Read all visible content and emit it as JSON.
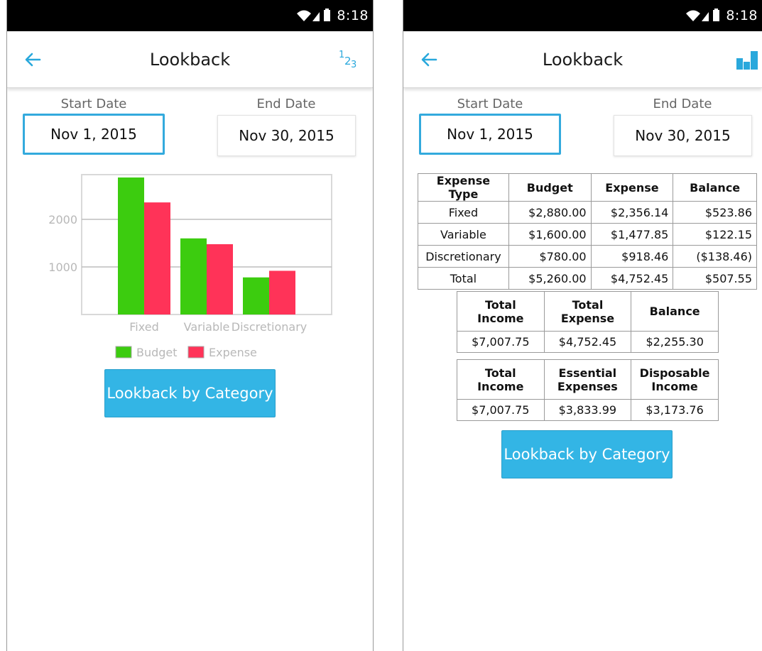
{
  "status_bar": {
    "time": "8:18"
  },
  "left_screen": {
    "title": "Lookback",
    "start_date_label": "Start Date",
    "end_date_label": "End Date",
    "start_date": "Nov 1, 2015",
    "end_date": "Nov 30, 2015",
    "toggle_icon": "numbers-123-icon",
    "button_label": "Lookback by Category"
  },
  "right_screen": {
    "title": "Lookback",
    "start_date_label": "Start Date",
    "end_date_label": "End Date",
    "start_date": "Nov 1, 2015",
    "end_date": "Nov 30, 2015",
    "toggle_icon": "bar-chart-icon",
    "button_label": "Lookback by Category",
    "expense_table": {
      "headers": [
        "Expense Type",
        "Budget",
        "Expense",
        "Balance"
      ],
      "rows": [
        [
          "Fixed",
          "$2,880.00",
          "$2,356.14",
          "$523.86"
        ],
        [
          "Variable",
          "$1,600.00",
          "$1,477.85",
          "$122.15"
        ],
        [
          "Discretionary",
          "$780.00",
          "$918.46",
          "($138.46)"
        ],
        [
          "Total",
          "$5,260.00",
          "$4,752.45",
          "$507.55"
        ]
      ]
    },
    "income_table": {
      "headers": [
        "Total Income",
        "Total Expense",
        "Balance"
      ],
      "row": [
        "$7,007.75",
        "$4,752.45",
        "$2,255.30"
      ]
    },
    "disposable_table": {
      "headers": [
        "Total Income",
        "Essential Expenses",
        "Disposable Income"
      ],
      "row": [
        "$7,007.75",
        "$3,833.99",
        "$3,173.76"
      ]
    }
  },
  "colors": {
    "accent": "#33b5e5",
    "budget": "#3ccc0f",
    "expense": "#ff3358",
    "positive": "#3cc13c",
    "negative": "#ff3355"
  },
  "chart_data": {
    "type": "bar",
    "categories": [
      "Fixed",
      "Variable",
      "Discretionary"
    ],
    "series": [
      {
        "name": "Budget",
        "values": [
          2880,
          1600,
          780
        ]
      },
      {
        "name": "Expense",
        "values": [
          2356.14,
          1477.85,
          918.46
        ]
      }
    ],
    "yticks": [
      1000,
      2000
    ],
    "ylim": [
      0,
      2940
    ],
    "grid": true,
    "legend": "bottom"
  }
}
